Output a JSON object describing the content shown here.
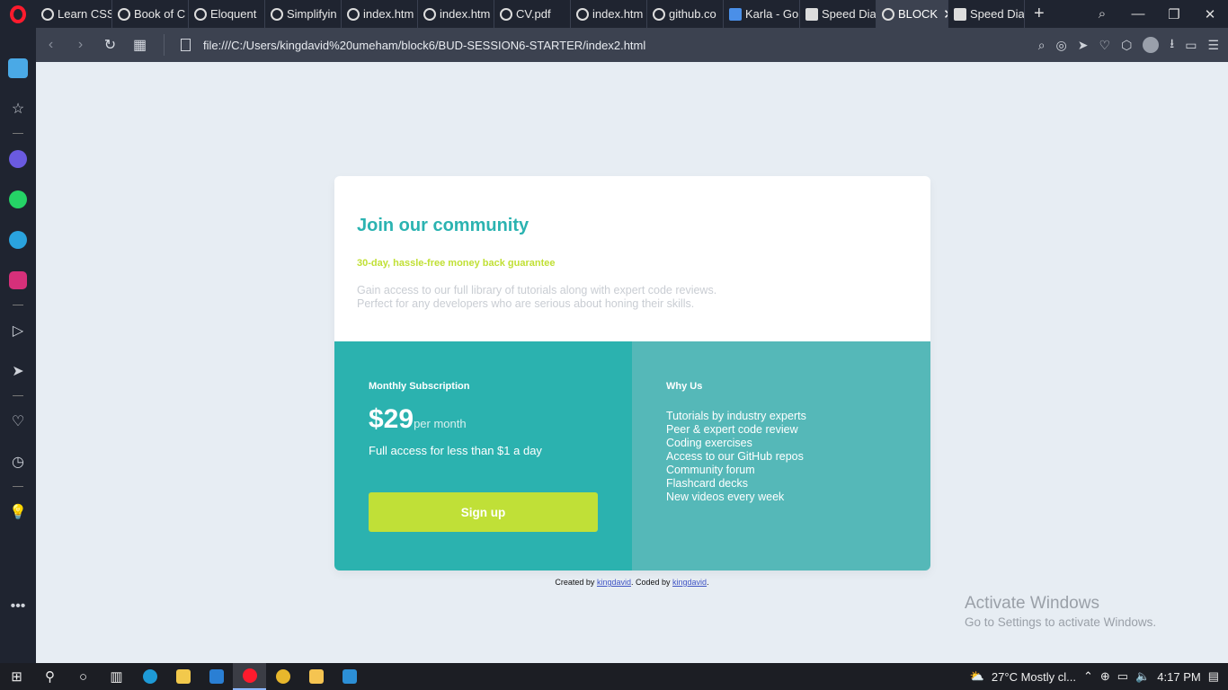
{
  "tabs": [
    {
      "label": "Learn CSS"
    },
    {
      "label": "Book of C"
    },
    {
      "label": "Eloquent"
    },
    {
      "label": "Simplifyin"
    },
    {
      "label": "index.htm"
    },
    {
      "label": "index.htm"
    },
    {
      "label": "CV.pdf"
    },
    {
      "label": "index.htm"
    },
    {
      "label": "github.co"
    },
    {
      "label": "Karla - Go"
    },
    {
      "label": "Speed Dia"
    },
    {
      "label": "BLOCK",
      "active": true
    },
    {
      "label": "Speed Dia"
    }
  ],
  "address": {
    "url": "file:///C:/Users/kingdavid%20umeham/block6/BUD-SESSION6-STARTER/index2.html"
  },
  "card": {
    "title": "Join our community",
    "subtitle": "30-day, hassle-free money back guarantee",
    "description": "Gain access to our full library of tutorials along with expert code reviews. Perfect for any developers who are serious about honing their skills.",
    "subscription": {
      "heading": "Monthly Subscription",
      "price": "$29",
      "period": "per month",
      "access": "Full access for less than $1 a day",
      "button": "Sign up"
    },
    "why": {
      "heading": "Why Us",
      "items": [
        "Tutorials by industry experts",
        "Peer & expert code review",
        "Coding exercises",
        "Access to our GitHub repos",
        "Community forum",
        "Flashcard decks",
        "New videos every week"
      ]
    }
  },
  "attribution": {
    "created_prefix": "Created by",
    "created_link": "kingdavid",
    "coded_prefix": ". Coded by",
    "coded_link": "kingdavid",
    "suffix": "."
  },
  "watermark": {
    "line1": "Activate Windows",
    "line2": "Go to Settings to activate Windows."
  },
  "taskbar": {
    "weather": "27°C  Mostly cl...",
    "time": "4:17 PM"
  },
  "colors": {
    "accent": "#2bb3b1",
    "highlight": "#c0e037",
    "right_panel": "#55b8b8"
  }
}
